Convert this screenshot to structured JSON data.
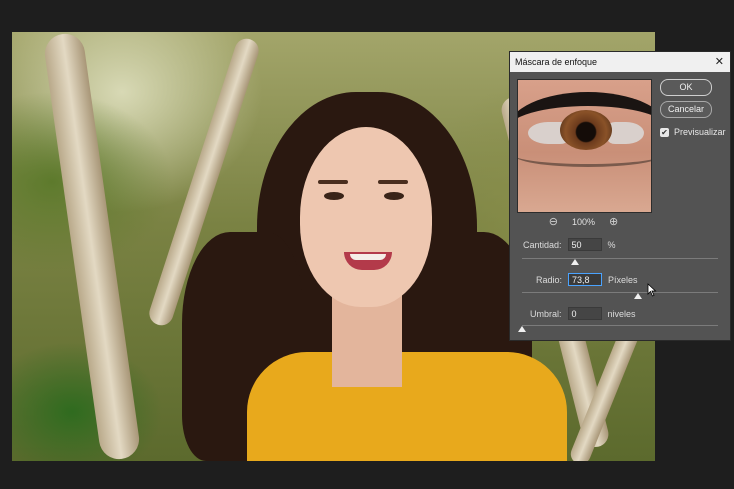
{
  "dialog": {
    "title": "Máscara de enfoque",
    "close_glyph": "✕",
    "ok_label": "OK",
    "cancel_label": "Cancelar",
    "preview_label": "Previsualizar",
    "preview_checked": true,
    "zoom_level": "100%",
    "zoom_out_icon": "zoom-out-icon",
    "zoom_in_icon": "zoom-in-icon",
    "amount": {
      "label": "Cantidad:",
      "value": "50",
      "unit": "%",
      "slider_fraction": 0.27
    },
    "radius": {
      "label": "Radio:",
      "value": "73,8",
      "unit": "Píxeles",
      "slider_fraction": 0.59
    },
    "threshold": {
      "label": "Umbral:",
      "value": "0",
      "unit": "niveles",
      "slider_fraction": 0.0
    }
  },
  "colors": {
    "dialog_bg": "#535353",
    "titlebar_bg": "#f0f0f0",
    "app_bg": "#1e1e1e",
    "active_field_border": "#4aa3ff"
  }
}
